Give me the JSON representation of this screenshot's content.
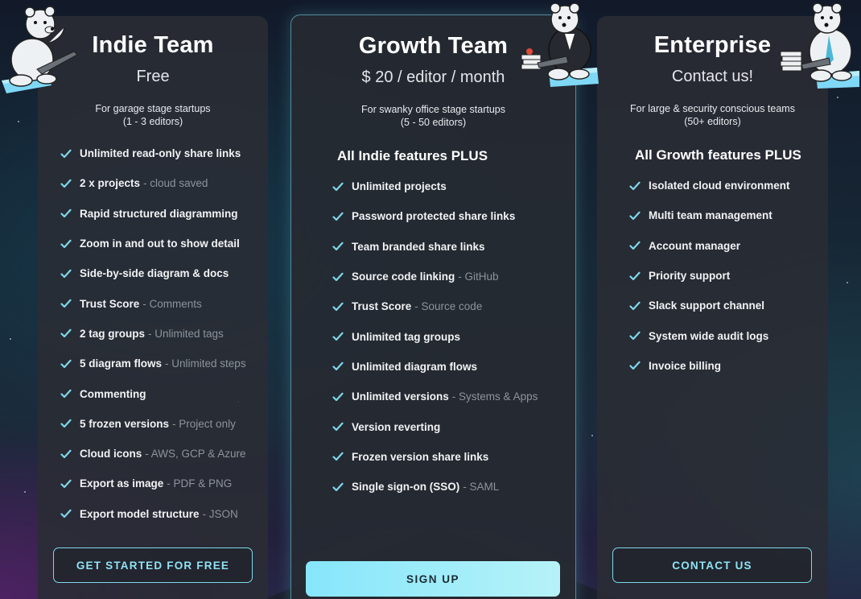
{
  "colors": {
    "accent": "#7fd8ea",
    "check": "#7fd8ea",
    "note": "#8d939c",
    "card": "#2a2c34"
  },
  "plans": [
    {
      "title": "Indie Team",
      "price": "Free",
      "desc_line1": "For garage stage startups",
      "desc_line2": "(1 - 3 editors)",
      "plus": "",
      "button": "GET STARTED FOR FREE",
      "features": [
        {
          "main": "Unlimited read-only share links",
          "note": ""
        },
        {
          "main": "2 x projects",
          "note": "- cloud saved"
        },
        {
          "main": "Rapid structured diagramming",
          "note": ""
        },
        {
          "main": "Zoom in and out to show detail",
          "note": ""
        },
        {
          "main": "Side-by-side diagram & docs",
          "note": ""
        },
        {
          "main": "Trust Score",
          "note": "- Comments"
        },
        {
          "main": "2 tag groups",
          "note": "- Unlimited tags"
        },
        {
          "main": "5 diagram flows",
          "note": "- Unlimited steps"
        },
        {
          "main": "Commenting",
          "note": ""
        },
        {
          "main": "5 frozen versions",
          "note": "- Project only"
        },
        {
          "main": "Cloud icons",
          "note": "- AWS, GCP & Azure"
        },
        {
          "main": "Export as image",
          "note": "- PDF & PNG"
        },
        {
          "main": "Export model structure",
          "note": "- JSON"
        }
      ]
    },
    {
      "title": "Growth Team",
      "price": "$ 20 / editor / month",
      "desc_line1": "For swanky office stage startups",
      "desc_line2": "(5 - 50 editors)",
      "plus": "All Indie features PLUS",
      "button": "SIGN UP",
      "features": [
        {
          "main": "Unlimited projects",
          "note": ""
        },
        {
          "main": "Password protected share links",
          "note": ""
        },
        {
          "main": "Team branded share links",
          "note": ""
        },
        {
          "main": "Source code linking",
          "note": "- GitHub"
        },
        {
          "main": "Trust Score",
          "note": "- Source code"
        },
        {
          "main": "Unlimited tag groups",
          "note": ""
        },
        {
          "main": "Unlimited diagram flows",
          "note": ""
        },
        {
          "main": "Unlimited versions",
          "note": "- Systems & Apps"
        },
        {
          "main": "Version reverting",
          "note": ""
        },
        {
          "main": "Frozen version share links",
          "note": ""
        },
        {
          "main": "Single sign-on (SSO)",
          "note": "- SAML"
        }
      ]
    },
    {
      "title": "Enterprise",
      "price": "Contact us!",
      "desc_line1": "For large & security conscious teams",
      "desc_line2": "(50+ editors)",
      "plus": "All Growth features PLUS",
      "button": "CONTACT US",
      "features": [
        {
          "main": "Isolated cloud environment",
          "note": ""
        },
        {
          "main": "Multi team management",
          "note": ""
        },
        {
          "main": "Account manager",
          "note": ""
        },
        {
          "main": "Priority support",
          "note": ""
        },
        {
          "main": "Slack support channel",
          "note": ""
        },
        {
          "main": "System wide audit logs",
          "note": ""
        },
        {
          "main": "Invoice billing",
          "note": ""
        }
      ]
    }
  ]
}
